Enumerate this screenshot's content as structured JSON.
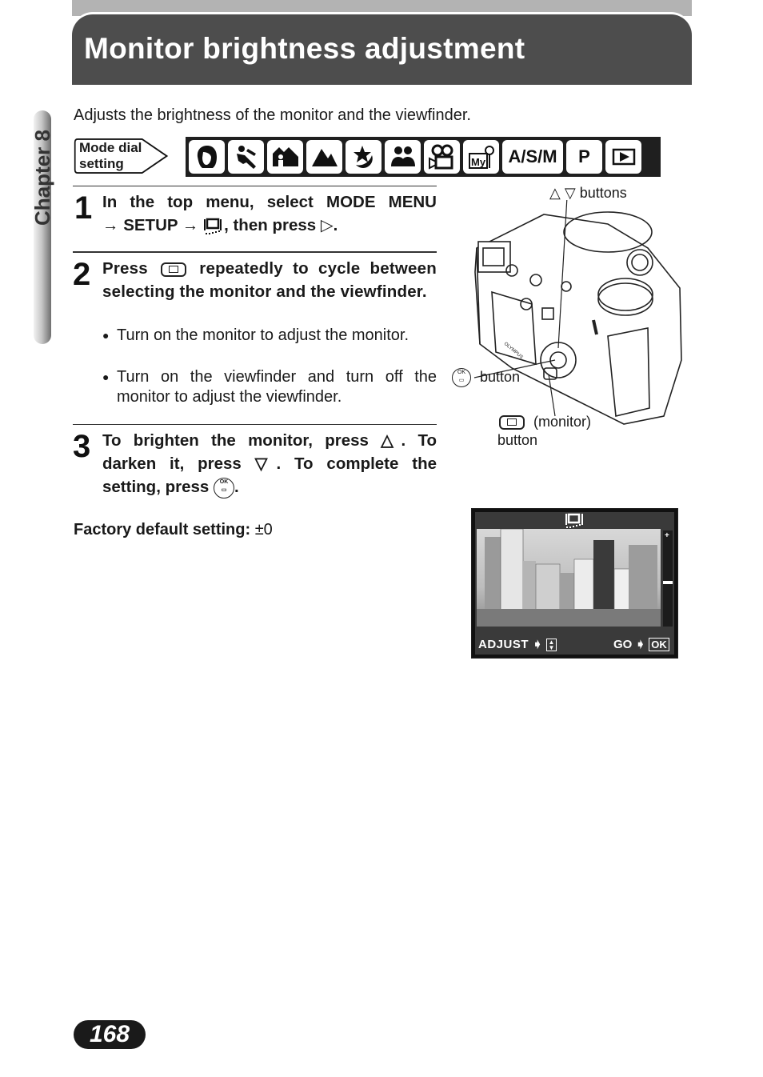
{
  "header": {
    "title": "Monitor brightness adjustment"
  },
  "chapter_tab": {
    "label": "Chapter 8"
  },
  "intro": "Adjusts the brightness of the monitor and the viewfinder.",
  "mode_dial": {
    "label_line1": "Mode dial",
    "label_line2": "setting",
    "modes": [
      {
        "icon": "portrait-icon"
      },
      {
        "icon": "sports-icon"
      },
      {
        "icon": "landscape-portrait-icon"
      },
      {
        "icon": "landscape-icon"
      },
      {
        "icon": "night-scene-icon"
      },
      {
        "icon": "self-portrait-icon"
      },
      {
        "icon": "movie-icon"
      },
      {
        "icon": "my-mode-icon",
        "text": "My"
      },
      {
        "icon": "asm-mode",
        "text": "A/S/M"
      },
      {
        "icon": "program-mode",
        "text": "P"
      },
      {
        "icon": "playback-icon",
        "text": "▶"
      }
    ]
  },
  "steps": [
    {
      "number": "1",
      "text_a": "In the top menu, select MODE MENU",
      "text_b_arrow": "→",
      "text_b_setup": "SETUP",
      "text_b_arrow2": "→",
      "text_b_rest": ", then press",
      "text_b_end": "."
    },
    {
      "number": "2",
      "text_press": "Press",
      "text_rest": "repeatedly to cycle between selecting the monitor and the viewfinder.",
      "bullets": [
        "Turn on the monitor to adjust the monitor.",
        "Turn on the viewfinder and turn off the monitor to adjust the viewfinder."
      ]
    },
    {
      "number": "3",
      "text_a": "To brighten the monitor, press △. To darken it, press ▽. To complete the setting, press",
      "text_end": "."
    }
  ],
  "factory_default": {
    "label": "Factory default setting:",
    "value": "±0"
  },
  "camera_callouts": {
    "updown": "△ ▽ buttons",
    "ok": "button",
    "monitor_a": "(monitor)",
    "monitor_b": "button"
  },
  "lcd": {
    "adjust_label": "ADJUST",
    "go_label": "GO",
    "ok_label": "OK",
    "brightness_level": 0,
    "brightness_range": [
      -7,
      7
    ]
  },
  "page_number": "168"
}
